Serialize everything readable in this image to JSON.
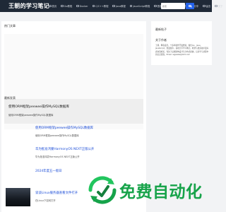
{
  "header": {
    "brand": "王朝的学习笔记",
    "nav": [
      {
        "label": "首页",
        "icon": "home-icon"
      },
      {
        "label": "Go教程",
        "icon": "book-icon"
      },
      {
        "label": "Docker",
        "icon": "book-icon"
      },
      {
        "label": "C/C++教程",
        "icon": "book-icon"
      },
      {
        "label": "Java教程",
        "icon": "book-icon"
      },
      {
        "label": "JavaScript教程",
        "icon": "book-icon"
      },
      {
        "label": "数据库",
        "icon": "database-icon"
      },
      {
        "label": "工具",
        "icon": "tool-icon"
      },
      {
        "label": "干货资源分享",
        "icon": "share-icon"
      },
      {
        "label": "留言",
        "icon": "message-icon"
      },
      {
        "label": "关于",
        "icon": "user-icon"
      }
    ],
    "search_placeholder": "搜索"
  },
  "main": {
    "hot_title": "热门文章",
    "featured": {
      "title": "使用ORM框架peewee操作MySQL数据库",
      "subtitle": "使用ORM框架peewee操作MySQL数据库"
    },
    "latest_title": "最新发表",
    "posts": [
      {
        "title": "使用ORM框架peewee操作MySQL数据库",
        "subtitle": "使用ORM框架peewee操作MySQL数据库"
      },
      {
        "title": "华为批准鸿蒙HarmonyOS NEXT正版公开",
        "subtitle": "华为批准鸿蒙HarmonyOS NEXT正版公开"
      },
      {
        "title": "2024年度五一假日",
        "subtitle": "2024年度五一假日"
      },
      {
        "title": "谈谈Linux服务器查看文件打开",
        "subtitle": "在Linux下如何打开"
      }
    ]
  },
  "sidebar": {
    "label": "最新帖子",
    "about_title": "关于作者",
    "about_text": "王朝，网名痕齐，十多年软件开发经验，擅长Go、Java、JavaScript，热爱技术，喜欢分享学习笔记，希望与更多技术爱好者交流成长。专注于后端架构设计与分布式系统，记录学习过程中的点点滴滴。Email: wgwaba@163.com"
  },
  "watermark": {
    "text": "免费自动化",
    "color": "#17a34a"
  }
}
